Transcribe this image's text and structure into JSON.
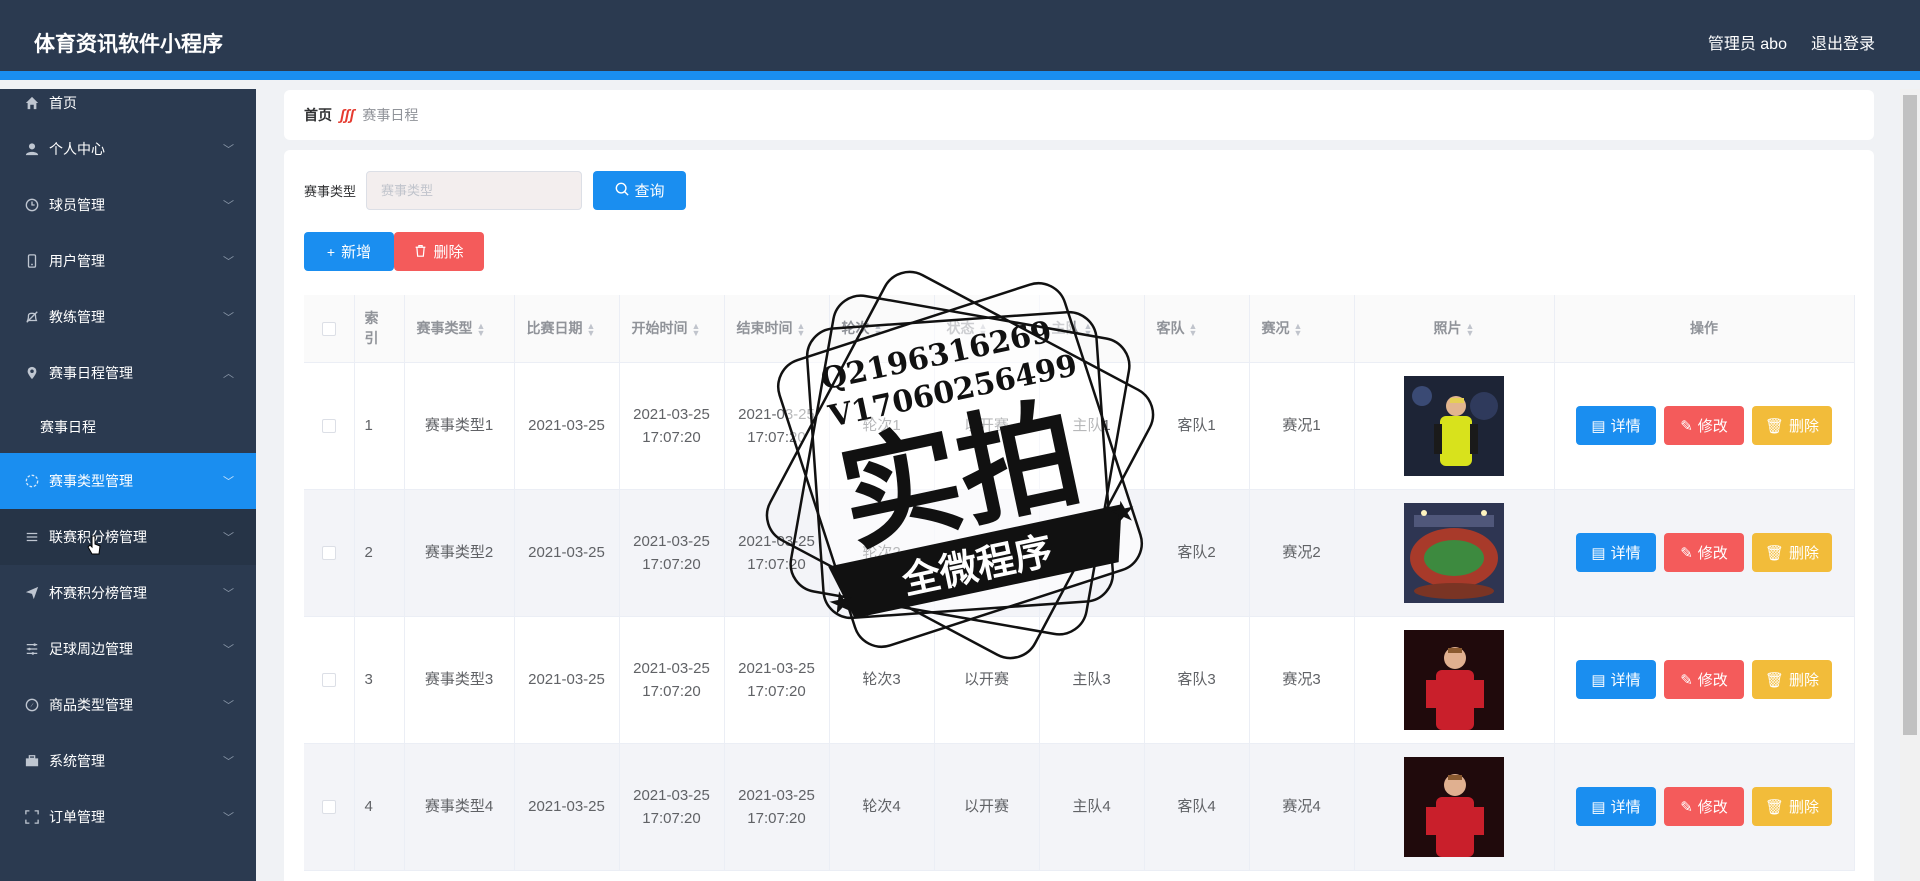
{
  "header": {
    "title": "体育资讯软件小程序",
    "admin_label": "管理员 abo",
    "logout_label": "退出登录"
  },
  "sidebar": {
    "items": [
      {
        "label": "首页",
        "icon": "home-icon"
      },
      {
        "label": "个人中心",
        "icon": "user-icon"
      },
      {
        "label": "球员管理",
        "icon": "clock-icon"
      },
      {
        "label": "用户管理",
        "icon": "phone-icon"
      },
      {
        "label": "教练管理",
        "icon": "bell-off-icon"
      },
      {
        "label": "赛事日程管理",
        "icon": "location-icon"
      },
      {
        "label": "赛事日程"
      },
      {
        "label": "赛事类型管理",
        "icon": "football-icon"
      },
      {
        "label": "联赛积分榜管理",
        "icon": "list-icon"
      },
      {
        "label": "杯赛积分榜管理",
        "icon": "send-icon"
      },
      {
        "label": "足球周边管理",
        "icon": "menu-icon"
      },
      {
        "label": "商品类型管理",
        "icon": "compass-icon"
      },
      {
        "label": "系统管理",
        "icon": "briefcase-icon"
      },
      {
        "label": "订单管理",
        "icon": "fullscreen-icon"
      }
    ]
  },
  "breadcrumb": {
    "home": "首页",
    "separator": "ʃʃʃ",
    "current": "赛事日程"
  },
  "search": {
    "label": "赛事类型",
    "placeholder": "赛事类型",
    "query_button": "查询"
  },
  "actions": {
    "add": "新增",
    "delete": "删除"
  },
  "table": {
    "headers": [
      "索引",
      "赛事类型",
      "比赛日期",
      "开始时间",
      "结束时间",
      "轮次",
      "状态",
      "主队",
      "客队",
      "赛况",
      "照片",
      "操作"
    ],
    "rows": [
      {
        "index": "1",
        "type": "赛事类型1",
        "date": "2021-03-25",
        "start_date": "2021-03-25",
        "start_time": "17:07:20",
        "end_date": "2021-03-25",
        "end_time": "17:07:20",
        "round": "轮次1",
        "status": "以开赛",
        "home": "主队1",
        "away": "客队1",
        "result": "赛况1"
      },
      {
        "index": "2",
        "type": "赛事类型2",
        "date": "2021-03-25",
        "start_date": "2021-03-25",
        "start_time": "17:07:20",
        "end_date": "2021-03-25",
        "end_time": "17:07:20",
        "round": "轮次2",
        "status": "以开赛",
        "home": "主队2",
        "away": "客队2",
        "result": "赛况2"
      },
      {
        "index": "3",
        "type": "赛事类型3",
        "date": "2021-03-25",
        "start_date": "2021-03-25",
        "start_time": "17:07:20",
        "end_date": "2021-03-25",
        "end_time": "17:07:20",
        "round": "轮次3",
        "status": "以开赛",
        "home": "主队3",
        "away": "客队3",
        "result": "赛况3"
      },
      {
        "index": "4",
        "type": "赛事类型4",
        "date": "2021-03-25",
        "start_date": "2021-03-25",
        "start_time": "17:07:20",
        "end_date": "2021-03-25",
        "end_time": "17:07:20",
        "round": "轮次4",
        "status": "以开赛",
        "home": "主队4",
        "away": "客队4",
        "result": "赛况4"
      }
    ],
    "row_actions": {
      "detail": "详情",
      "edit": "修改",
      "delete": "删除"
    }
  },
  "watermark": {
    "line1": "Q2196316269",
    "line2": "V17060256499",
    "main": "实拍",
    "banner": "全微程序"
  },
  "colors": {
    "header_bg": "#2b3a50",
    "accent": "#1a8ef0",
    "danger": "#f45b5b",
    "warning": "#f2bc3a"
  }
}
